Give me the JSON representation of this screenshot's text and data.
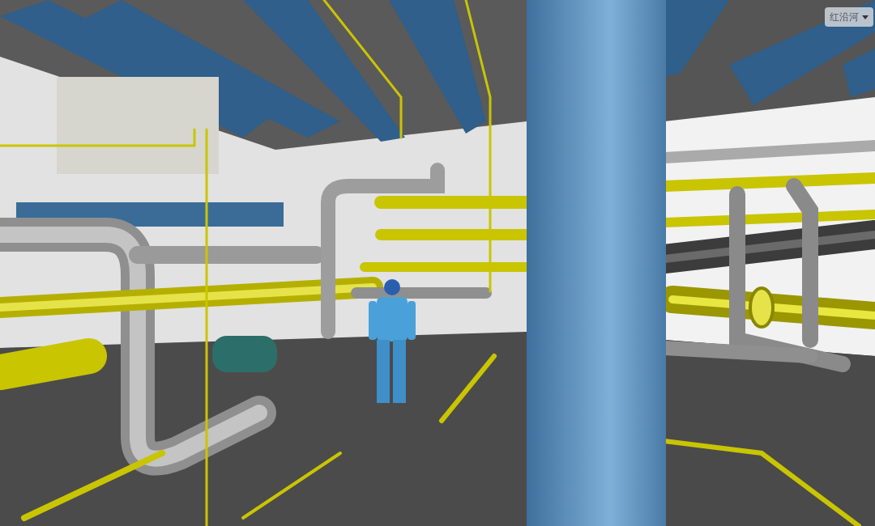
{
  "site_selector": {
    "value": "红沿河"
  }
}
